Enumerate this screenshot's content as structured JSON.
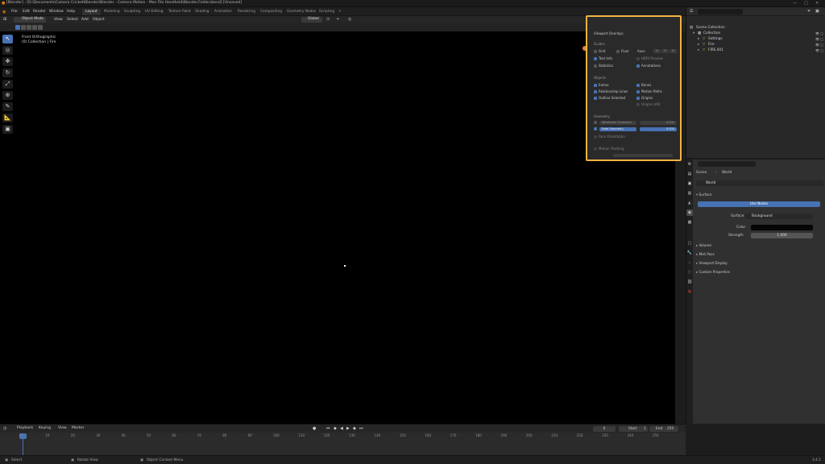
{
  "title_bar": {
    "title": "[Blender] - [D:\\Documents\\Camera Cricket\\Blender\\Blender - Camera Motion - Mon File Handheld\\Blender.Folder.blend] [Unsaved]",
    "window_controls": [
      "—",
      "□",
      "✕"
    ]
  },
  "menu": {
    "items": [
      "File",
      "Edit",
      "Render",
      "Window",
      "Help"
    ]
  },
  "workspaces": [
    {
      "label": "Layout",
      "active": true
    },
    {
      "label": "Modeling",
      "active": false
    },
    {
      "label": "Sculpting",
      "active": false
    },
    {
      "label": "UV Editing",
      "active": false
    },
    {
      "label": "Texture Paint",
      "active": false
    },
    {
      "label": "Shading",
      "active": false
    },
    {
      "label": "Animation",
      "active": false
    },
    {
      "label": "Rendering",
      "active": false
    },
    {
      "label": "Compositing",
      "active": false
    },
    {
      "label": "Geometry Nodes",
      "active": false
    },
    {
      "label": "Scripting",
      "active": false
    }
  ],
  "scene_selector": {
    "value": "Scene"
  },
  "view_layer_selector": {
    "value": "ViewLayer"
  },
  "viewport_header": {
    "mode": "Object Mode",
    "menus": [
      "View",
      "Select",
      "Add",
      "Object"
    ],
    "orientation": "Global"
  },
  "viewport": {
    "view_name": "Front Orthographic",
    "collection_line": "(0) Collection | Fire"
  },
  "overlays": {
    "heading": "Viewport Overlays",
    "guides_heading": "Guides",
    "grid": "Grid",
    "floor": "Floor",
    "axes": "Axes",
    "axis_letters": [
      "X",
      "Y",
      "Z"
    ],
    "text_info": "Text Info",
    "hdri": "HDRI Preview",
    "statistics": "Statistics",
    "annotations": "Annotations",
    "objects_heading": "Objects",
    "extras": "Extras",
    "bones": "Bones",
    "relationship_lines": "Relationship Lines",
    "motion_paths": "Motion Paths",
    "outline_selected": "Outline Selected",
    "origins": "Origins",
    "origins_all": "Origins (All)",
    "geometry_heading": "Geometry",
    "wireframe_threshold": "Wireframe Threshold",
    "wireframe_value": "0.500",
    "fade_geometry": "Fade Geometry",
    "fade_value": "0.500",
    "face_orientation": "Face Orientation",
    "motion_tracking": "Motion Tracking"
  },
  "outliner": {
    "header": "Scene Collection",
    "rows": [
      {
        "label": "Collection",
        "indent": 0
      },
      {
        "label": "Settings",
        "indent": 1
      },
      {
        "label": "Fire",
        "indent": 1
      },
      {
        "label": "FIRE.001",
        "indent": 1
      }
    ]
  },
  "properties": {
    "breadcrumb_scene": "Scene",
    "breadcrumb_world": "World",
    "world_name": "World",
    "surface_heading": "Surface",
    "use_nodes": "Use Nodes",
    "surface_label": "Surface",
    "surface_value": "Background",
    "color_label": "Color",
    "strength_label": "Strength",
    "strength_value": "1.000",
    "collapsed_sections": [
      "Volume",
      "Mist Pass",
      "Viewport Display",
      "Custom Properties"
    ]
  },
  "timeline": {
    "menus": [
      "Playback",
      "Keying",
      "View",
      "Marker"
    ],
    "current_frame": "0",
    "start_label": "Start",
    "start_value": "1",
    "end_label": "End",
    "end_value": "250",
    "ruler": [
      "0",
      "10",
      "20",
      "30",
      "40",
      "50",
      "60",
      "70",
      "80",
      "90",
      "100",
      "110",
      "120",
      "130",
      "140",
      "150",
      "160",
      "170",
      "180",
      "190",
      "200",
      "210",
      "220",
      "230",
      "240",
      "250"
    ]
  },
  "statusbar": {
    "select": "Select",
    "rotate": "Rotate View",
    "context": "Object Context Menu",
    "version": "3.4.1"
  }
}
